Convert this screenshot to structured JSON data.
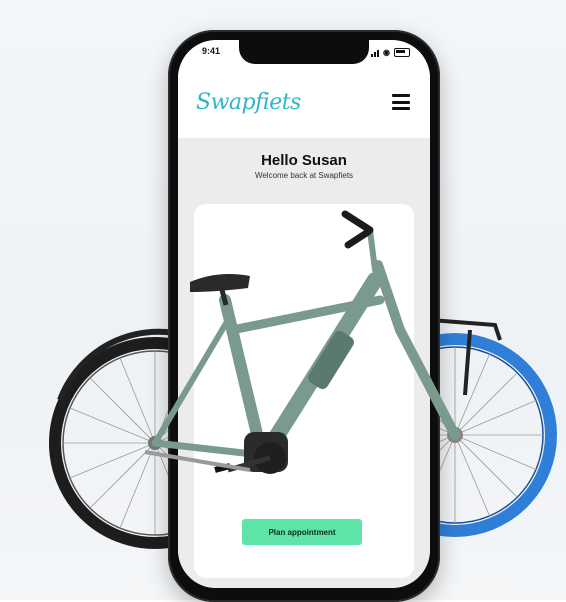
{
  "status_bar": {
    "time": "9:41"
  },
  "header": {
    "logo_text": "Swapfiets",
    "menu_icon": "hamburger-menu-icon"
  },
  "greeting": {
    "title": "Hello Susan",
    "subtitle": "Welcome back at Swapfiets"
  },
  "cta": {
    "label": "Plan appointment"
  },
  "colors": {
    "brand_teal": "#2fb5c9",
    "cta_green": "#5fe4a8",
    "bike_frame": "#7a9a8e",
    "front_tire": "#2f7fd8"
  }
}
